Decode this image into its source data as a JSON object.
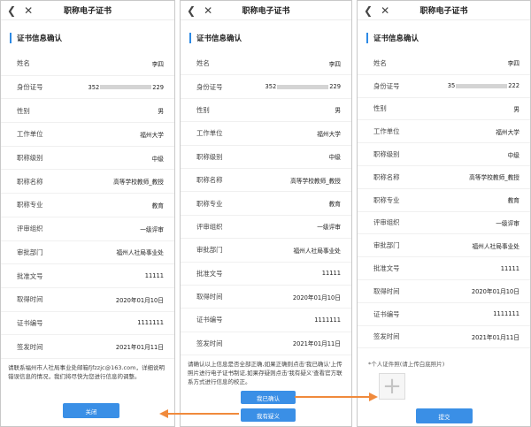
{
  "title": "职称电子证书",
  "section_title": "证书信息确认",
  "icons": {
    "back": "back-chevron-icon",
    "close": "close-x-icon",
    "upload": "plus-icon"
  },
  "accent_color": "#3a8fe6",
  "arrow_color": "#f08a3c",
  "panel1": {
    "rows": [
      {
        "label": "姓名",
        "value": "李四"
      },
      {
        "label": "身份证号",
        "value_prefix": "352",
        "value_suffix": "229"
      },
      {
        "label": "性别",
        "value": "男"
      },
      {
        "label": "工作单位",
        "value": "福州大学"
      },
      {
        "label": "职称级别",
        "value": "中级"
      },
      {
        "label": "职称名称",
        "value": "高等学校教师_教授"
      },
      {
        "label": "职称专业",
        "value": "教育"
      },
      {
        "label": "评审组织",
        "value": "一级评审"
      },
      {
        "label": "审批部门",
        "value": "福州人社局事业处"
      },
      {
        "label": "批准文号",
        "value": "11111"
      },
      {
        "label": "取得时间",
        "value": "2020年01月10日"
      },
      {
        "label": "证书编号",
        "value": "1111111"
      },
      {
        "label": "签发时间",
        "value": "2021年01月11日"
      }
    ],
    "note": "请联系福州市人社局事业处邮箱fjfzzjc@163.com，详细说明错误信息的情况，我们将尽快为您进行信息的调整。",
    "close_button": "关闭"
  },
  "panel2": {
    "rows": [
      {
        "label": "姓名",
        "value": "李四"
      },
      {
        "label": "身份证号",
        "value_prefix": "352",
        "value_suffix": "229"
      },
      {
        "label": "性别",
        "value": "男"
      },
      {
        "label": "工作单位",
        "value": "福州大学"
      },
      {
        "label": "职称级别",
        "value": "中级"
      },
      {
        "label": "职称名称",
        "value": "高等学校教师_教授"
      },
      {
        "label": "职称专业",
        "value": "教育"
      },
      {
        "label": "评审组织",
        "value": "一级评审"
      },
      {
        "label": "审批部门",
        "value": "福州人社局事业处"
      },
      {
        "label": "批准文号",
        "value": "11111"
      },
      {
        "label": "取得时间",
        "value": "2020年01月10日"
      },
      {
        "label": "证书编号",
        "value": "1111111"
      },
      {
        "label": "签发时间",
        "value": "2021年01月11日"
      }
    ],
    "note": "请确认以上信息是否全部正确,如果正确则点击'我已确认'上传照片进行电子证书制证,如果存疑则点击'我有疑义'查看官方联系方式进行信息的校正。",
    "confirm_button": "我已确认",
    "doubt_button": "我有疑义"
  },
  "panel3": {
    "rows": [
      {
        "label": "姓名",
        "value": "李四"
      },
      {
        "label": "身份证号",
        "value_prefix": "35",
        "value_suffix": "222"
      },
      {
        "label": "性别",
        "value": "男"
      },
      {
        "label": "工作单位",
        "value": "福州大学"
      },
      {
        "label": "职称级别",
        "value": "中级"
      },
      {
        "label": "职称名称",
        "value": "高等学校教师_教授"
      },
      {
        "label": "职称专业",
        "value": "教育"
      },
      {
        "label": "评审组织",
        "value": "一级评审"
      },
      {
        "label": "审批部门",
        "value": "福州人社局事业处"
      },
      {
        "label": "批准文号",
        "value": "11111"
      },
      {
        "label": "取得时间",
        "value": "2020年01月10日"
      },
      {
        "label": "证书编号",
        "value": "1111111"
      },
      {
        "label": "签发时间",
        "value": "2021年01月11日"
      }
    ],
    "photo_label": "*个人证件照(请上传白底照片)",
    "submit_button": "提交"
  }
}
